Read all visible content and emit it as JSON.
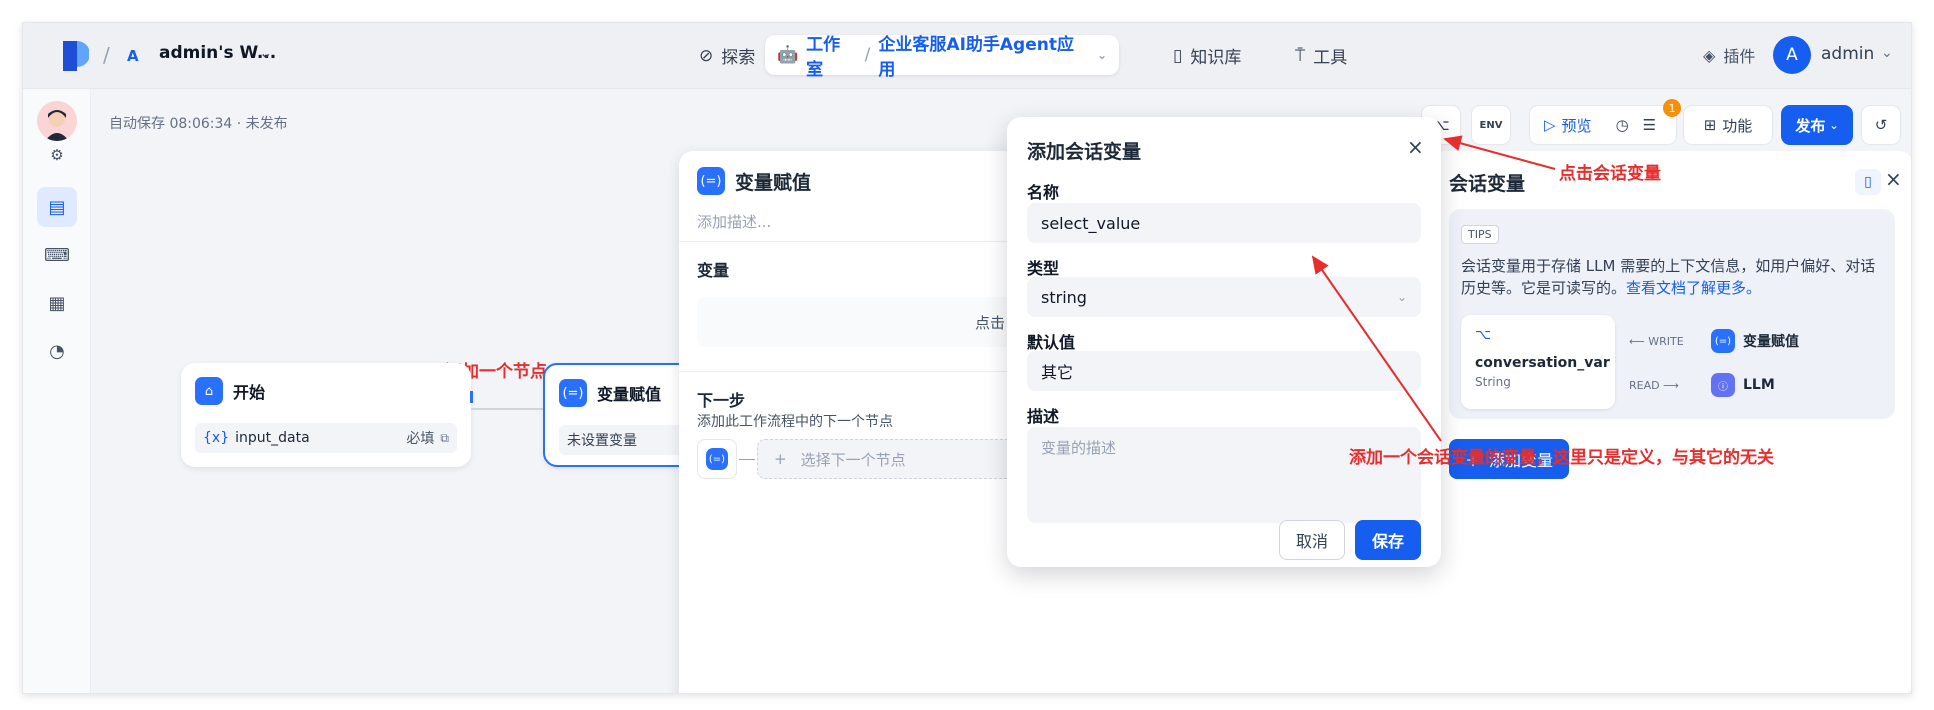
{
  "header": {
    "workspace_letter": "A",
    "workspace_name": "admin's W...",
    "nav_explore": "探索",
    "nav_studio": "工作室",
    "app_name": "企业客服AI助手Agent应用",
    "nav_knowledge": "知识库",
    "nav_tools": "工具",
    "plugins": "插件",
    "user_initial": "A",
    "user_name": "admin"
  },
  "canvas": {
    "autosave": "自动保存 08:06:34 · 未发布",
    "start_node": {
      "title": "开始",
      "var": "input_data",
      "required": "必填"
    },
    "assign_node": {
      "title": "变量赋值",
      "placeholder": "未设置变量"
    },
    "annotation_add_node": "添加一个节点"
  },
  "assign_panel": {
    "title": "变量赋值",
    "desc_placeholder": "添加描述...",
    "var_section": "变量",
    "var_click": "点击",
    "next_step": "下一步",
    "next_desc": "添加此工作流程中的下一个节点",
    "select_next": "选择下一个节点"
  },
  "toolbar": {
    "env": "ENV",
    "preview": "预览",
    "badge": "1",
    "features": "功能",
    "publish": "发布"
  },
  "dialog": {
    "title": "添加会话变量",
    "name_label": "名称",
    "name_value": "select_value",
    "type_label": "类型",
    "type_value": "string",
    "default_label": "默认值",
    "default_value": "其它",
    "desc_label": "描述",
    "desc_placeholder": "变量的描述",
    "cancel": "取消",
    "save": "保存"
  },
  "conv_panel": {
    "title": "会话变量",
    "tips_badge": "TIPS",
    "tips_text": "会话变量用于存储 LLM 需要的上下文信息，如用户偏好、对话历史等。它是可读写的。",
    "tips_link": "查看文档了解更多。",
    "var_name": "conversation_var",
    "var_type": "String",
    "write_label": "WRITE",
    "write_target": "变量赋值",
    "read_label": "READ",
    "read_target": "LLM",
    "add_button": "添加变量"
  },
  "annotations": {
    "click_conv_var": "点击会话变量",
    "add_conv_var": "添加一个会话变量的变量，这里只是定义，与其它的无关"
  },
  "colors": {
    "accent": "#155eef",
    "annotation": "#e62e2e"
  }
}
